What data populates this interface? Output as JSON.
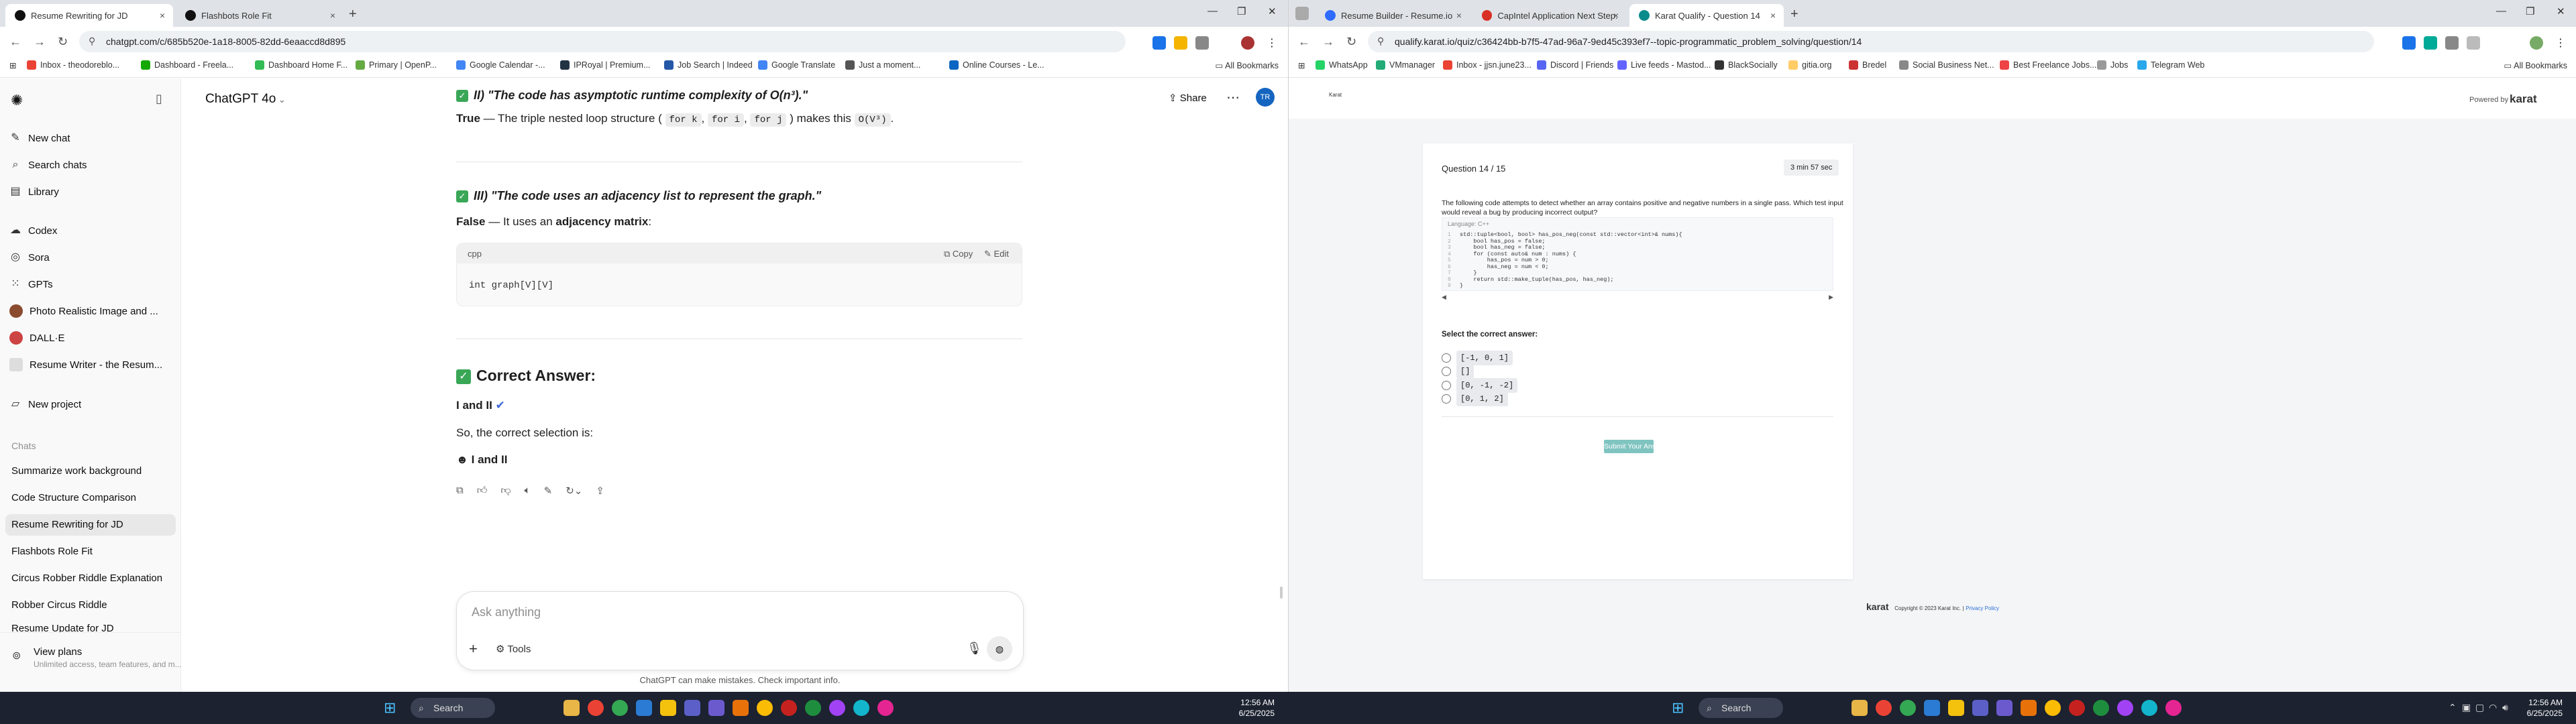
{
  "left": {
    "tabs": [
      {
        "title": "Resume Rewriting for JD",
        "active": true,
        "color": "#111111"
      },
      {
        "title": "Flashbots Role Fit",
        "active": false,
        "color": "#111111"
      }
    ],
    "url": "chatgpt.com/c/685b520e-1a18-8005-82dd-6eaaccd8d895",
    "bookmarks": [
      "Inbox - theodoreblo...",
      "Dashboard - Freela...",
      "Dashboard Home F...",
      "Primary | OpenP...",
      "Google Calendar -...",
      "IPRoyal | Premium...",
      "Job Search | Indeed",
      "Google Translate",
      "Just a moment...",
      "Online Courses - Le..."
    ],
    "all_bookmarks": "All Bookmarks",
    "sidebar": {
      "top": [
        {
          "icon": "edit-icon",
          "glyph": "✎",
          "label": "New chat"
        },
        {
          "icon": "search-icon",
          "glyph": "⌕",
          "label": "Search chats"
        },
        {
          "icon": "library-icon",
          "glyph": "▤",
          "label": "Library"
        }
      ],
      "apps": [
        {
          "icon": "codex-icon",
          "glyph": "☁",
          "label": "Codex"
        },
        {
          "icon": "sora-icon",
          "glyph": "◎",
          "label": "Sora"
        },
        {
          "icon": "gpts-icon",
          "glyph": "⁙",
          "label": "GPTs"
        },
        {
          "icon": "photo-gpt-avatar",
          "glyph": "",
          "label": "Photo Realistic Image and ..."
        },
        {
          "icon": "dalle-avatar",
          "glyph": "",
          "label": "DALL·E"
        },
        {
          "icon": "resume-writer-avatar",
          "glyph": "",
          "label": "Resume Writer - the Resum..."
        }
      ],
      "new_project": "New project",
      "chats_heading": "Chats",
      "chats": [
        "Summarize work background",
        "Code Structure Comparison",
        "Resume Rewriting for JD",
        "Flashbots Role Fit",
        "Circus Robber Riddle Explanation",
        "Robber Circus Riddle",
        "Resume Update for JD"
      ],
      "selected_chat": "Resume Rewriting for JD",
      "view_plans": "View plans",
      "view_plans_sub": "Unlimited access, team features, and m..."
    },
    "header": {
      "model": "ChatGPT 4o",
      "share": "Share",
      "avatar": "TR"
    },
    "message": {
      "item2_title": "II) \"The code has asymptotic runtime complexity of O(n³).\"",
      "item2_verdict": "True",
      "item2_text": "— The triple nested loop structure (",
      "item2_code1": "for k",
      "item2_code2": "for i",
      "item2_code3": "for j",
      "item2_text2": ") makes this",
      "item2_code4": "O(V³)",
      "item3_title": "III) \"The code uses an adjacency list to represent the graph.\"",
      "item3_verdict": "False",
      "item3_text": "— It uses an",
      "item3_bold": "adjacency matrix",
      "code_lang": "cpp",
      "copy": "Copy",
      "edit": "Edit",
      "code_line": "int graph[V][V]",
      "correct_heading": "Correct Answer:",
      "correct_value": "I and II",
      "so_text": "So, the correct selection is:",
      "final_answer": "I and II"
    },
    "composer": {
      "placeholder": "Ask anything",
      "tools": "Tools"
    },
    "disclaimer": "ChatGPT can make mistakes. Check important info."
  },
  "right": {
    "tabs": [
      {
        "title": "Resume Builder - Resume.io",
        "active": false,
        "color": "#2f6bff"
      },
      {
        "title": "CapIntel Application Next Step...",
        "active": false,
        "color": "#d93025"
      },
      {
        "title": "Karat Qualify - Question 14",
        "active": true,
        "color": "#0b8b8b"
      }
    ],
    "url": "qualify.karat.io/quiz/c36424bb-b7f5-47ad-96a7-9ed45c393ef7--topic-programmatic_problem_solving/question/14",
    "bookmarks": [
      "WhatsApp",
      "VMmanager",
      "Inbox - jjsn.june23...",
      "Discord | Friends",
      "Live feeds - Mastod...",
      "BlackSocially",
      "gitia.org",
      "Bredel",
      "Social Business Net...",
      "Best Freelance Jobs...",
      "Jobs",
      "Telegram Web"
    ],
    "all_bookmarks": "All Bookmarks",
    "karat": {
      "logo_small": "Karat",
      "powered_by": "Powered by",
      "brand": "karat",
      "question_label": "Question 14 / 15",
      "timer": "3 min 57 sec",
      "prompt": "The following code attempts to detect whether an array contains positive and negative numbers in a single pass. Which test input would reveal a bug by producing incorrect output?",
      "language": "Language: C++",
      "code_lines": [
        "std::tuple<bool, bool> has_pos_neg(const std::vector<int>& nums){",
        "    bool has_pos = false;",
        "    bool has_neg = false;",
        "    for (const auto& num : nums) {",
        "        has_pos = num > 0;",
        "        has_neg = num < 0;",
        "    }",
        "    return std::make_tuple(has_pos, has_neg);",
        "}"
      ],
      "select_label": "Select the correct answer:",
      "options": [
        "[-1, 0, 1]",
        "[]",
        "[0, -1, -2]",
        "[0, 1, 2]"
      ],
      "submit": "Submit Your Answer",
      "footer_brand": "karat",
      "copyright": "Copyright © 2023 Karat Inc. |",
      "privacy": "Privacy Policy",
      "accent": "#7fc4c0"
    }
  },
  "taskbar": {
    "search": "Search",
    "time": "12:56 AM",
    "date": "6/25/2025"
  }
}
